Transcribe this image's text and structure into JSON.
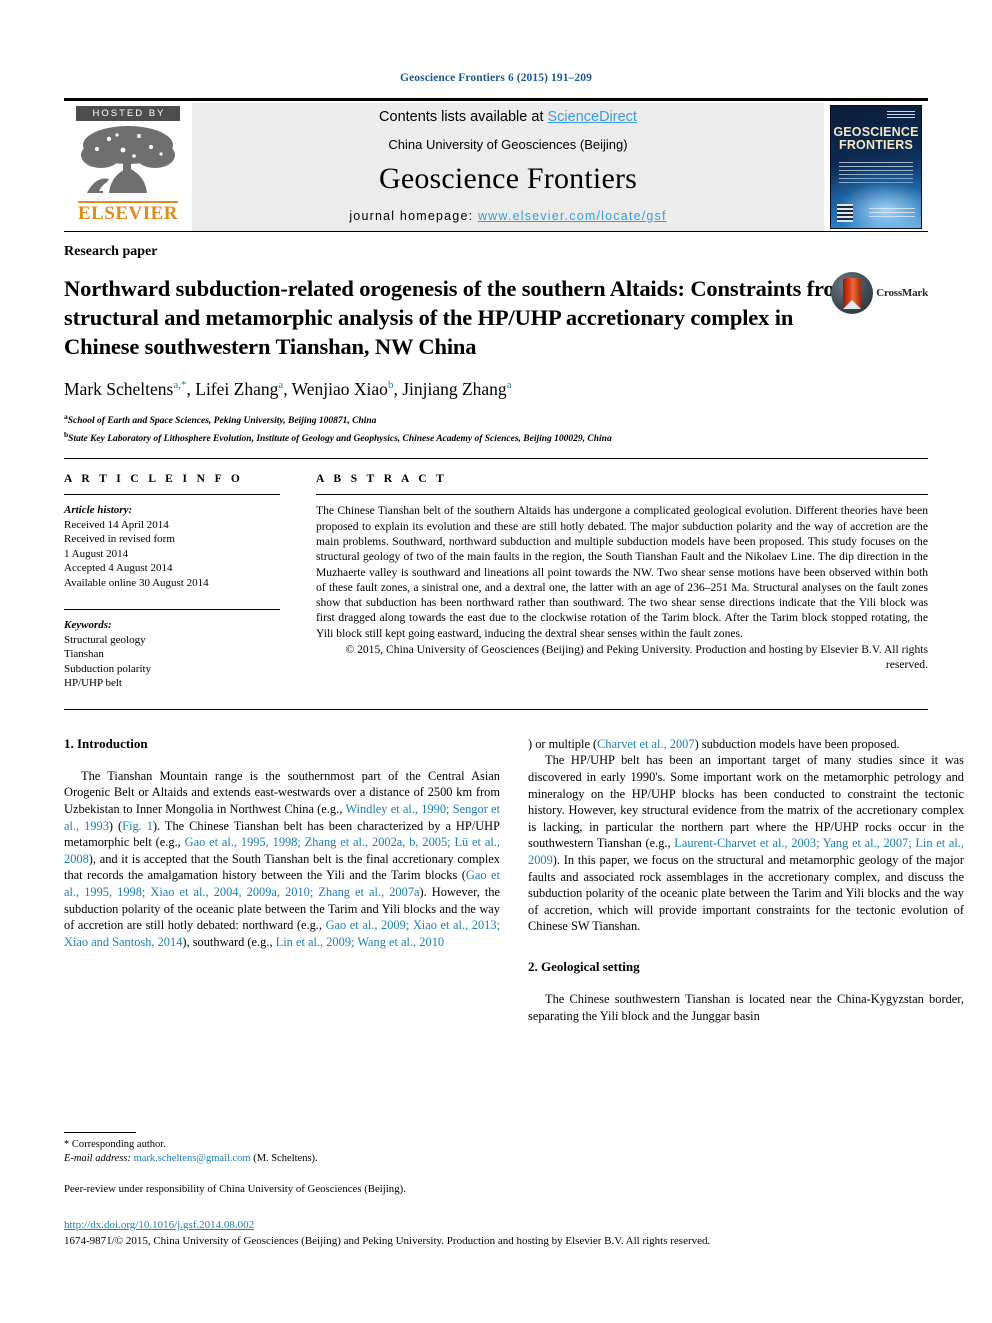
{
  "running_head": "Geoscience Frontiers 6 (2015) 191–209",
  "masthead": {
    "hosted_by": "HOSTED BY",
    "publisher_wordmark": "ELSEVIER",
    "contents_line_prefix": "Contents lists available at ",
    "contents_line_link": "ScienceDirect",
    "society": "China University of Geosciences (Beijing)",
    "journal_title": "Geoscience Frontiers",
    "homepage_label": "journal homepage: ",
    "homepage_url": "www.elsevier.com/locate/gsf",
    "cover_title_line1": "GEOSCIENCE",
    "cover_title_line2": "FRONTIERS",
    "link_color": "#3b9ad9"
  },
  "article": {
    "kind": "Research paper",
    "title": "Northward subduction-related orogenesis of the southern Altaids: Constraints from structural and metamorphic analysis of the HP/UHP accretionary complex in Chinese southwestern Tianshan, NW China",
    "crossmark_label": "CrossMark",
    "authors_html": "Mark Scheltens <sup>a,*</sup>, Lifei Zhang <sup>a</sup>, Wenjiao Xiao <sup>b</sup>, Jinjiang Zhang <sup>a</sup>",
    "affiliations": [
      "School of Earth and Space Sciences, Peking University, Beijing 100871, China",
      "State Key Laboratory of Lithosphere Evolution, Institute of Geology and Geophysics, Chinese Academy of Sciences, Beijing 100029, China"
    ],
    "affiliation_markers": [
      "a",
      "b"
    ]
  },
  "article_info": {
    "heading": "A R T I C L E   I N F O",
    "history_label": "Article history:",
    "history": [
      "Received 14 April 2014",
      "Received in revised form",
      "1 August 2014",
      "Accepted 4 August 2014",
      "Available online 30 August 2014"
    ],
    "keywords_label": "Keywords:",
    "keywords": [
      "Structural geology",
      "Tianshan",
      "Subduction polarity",
      "HP/UHP belt"
    ]
  },
  "abstract": {
    "heading": "A B S T R A C T",
    "text": "The Chinese Tianshan belt of the southern Altaids has undergone a complicated geological evolution. Different theories have been proposed to explain its evolution and these are still hotly debated. The major subduction polarity and the way of accretion are the main problems. Southward, northward subduction and multiple subduction models have been proposed. This study focuses on the structural geology of two of the main faults in the region, the South Tianshan Fault and the Nikolaev Line. The dip direction in the Muzhaerte valley is southward and lineations all point towards the NW. Two shear sense motions have been observed within both of these fault zones, a sinistral one, and a dextral one, the latter with an age of 236–251 Ma. Structural analyses on the fault zones show that subduction has been northward rather than southward. The two shear sense directions indicate that the Yili block was first dragged along towards the east due to the clockwise rotation of the Tarim block. After the Tarim block stopped rotating, the Yili block still kept going eastward, inducing the dextral shear senses within the fault zones.",
    "copyright": "© 2015, China University of Geosciences (Beijing) and Peking University. Production and hosting by Elsevier B.V. All rights reserved."
  },
  "body": {
    "section1_heading": "1.  Introduction",
    "section2_heading": "2.  Geological setting",
    "p1_a": "The Tianshan Mountain range is the southernmost part of the Central Asian Orogenic Belt or Altaids and extends east-westwards over a distance of 2500 km from Uzbekistan to Inner Mongolia in Northwest China (e.g., ",
    "p1_ref1": "Windley et al., 1990; Sengor et al., 1993",
    "p1_b": ") (",
    "p1_ref2": "Fig. 1",
    "p1_c": "). The Chinese Tianshan belt has been characterized by a HP/UHP metamorphic belt (e.g., ",
    "p1_ref3": "Gao et al., 1995, 1998; Zhang et al., 2002a, b, 2005; Lü et al., 2008",
    "p1_d": "), and it is accepted that the South Tianshan belt is the final accretionary complex that records the amalgamation history between the Yili and the Tarim blocks (",
    "p1_ref4": "Gao et al., 1995, 1998; Xiao et al., 2004, 2009a, 2010; Zhang et al., 2007a",
    "p1_e": "). However, the subduction polarity of the oceanic plate between the Tarim and Yili blocks and the way of accretion are still hotly debated: northward (e.g., ",
    "p1_ref5": "Gao et al., 2009; Xiao et al., 2013; Xiao and Santosh, 2014",
    "p1_f": "), southward (e.g., ",
    "p1_ref6": "Lin et al., 2009; Wang et al., 2010",
    "p1_g": ") or multiple (",
    "p1_ref7": "Charvet et al., 2007",
    "p1_h": ") subduction models have been proposed.",
    "p2_a": "The HP/UHP belt has been an important target of many studies since it was discovered in early 1990's. Some important work on the metamorphic petrology and mineralogy on the HP/UHP blocks has been conducted to constraint the tectonic history. However, key structural evidence from the matrix of the accretionary complex is lacking, in particular the northern part where the HP/UHP rocks occur in the southwestern Tianshan (e.g., ",
    "p2_ref1": "Laurent-Charvet et al., 2003; Yang et al., 2007; Lin et al., 2009",
    "p2_b": "). In this paper, we focus on the structural and metamorphic geology of the major faults and associated rock assemblages in the accretionary complex, and discuss the subduction polarity of the oceanic plate between the Tarim and Yili blocks and the way of accretion, which will provide important constraints for the tectonic evolution of Chinese SW Tianshan.",
    "p3": "The Chinese southwestern Tianshan is located near the China-Kygyzstan border, separating the Yili block and the Junggar basin"
  },
  "footnotes": {
    "corresponding": "* Corresponding author.",
    "email_label": "E-mail address: ",
    "email": "mark.scheltens@gmail.com",
    "email_suffix": " (M. Scheltens).",
    "peer_review": "Peer-review under responsibility of China University of Geosciences (Beijing).",
    "doi": "http://dx.doi.org/10.1016/j.gsf.2014.08.002",
    "issn_line": "1674-9871/© 2015, China University of Geosciences (Beijing) and Peking University. Production and hosting by Elsevier B.V. All rights reserved."
  }
}
